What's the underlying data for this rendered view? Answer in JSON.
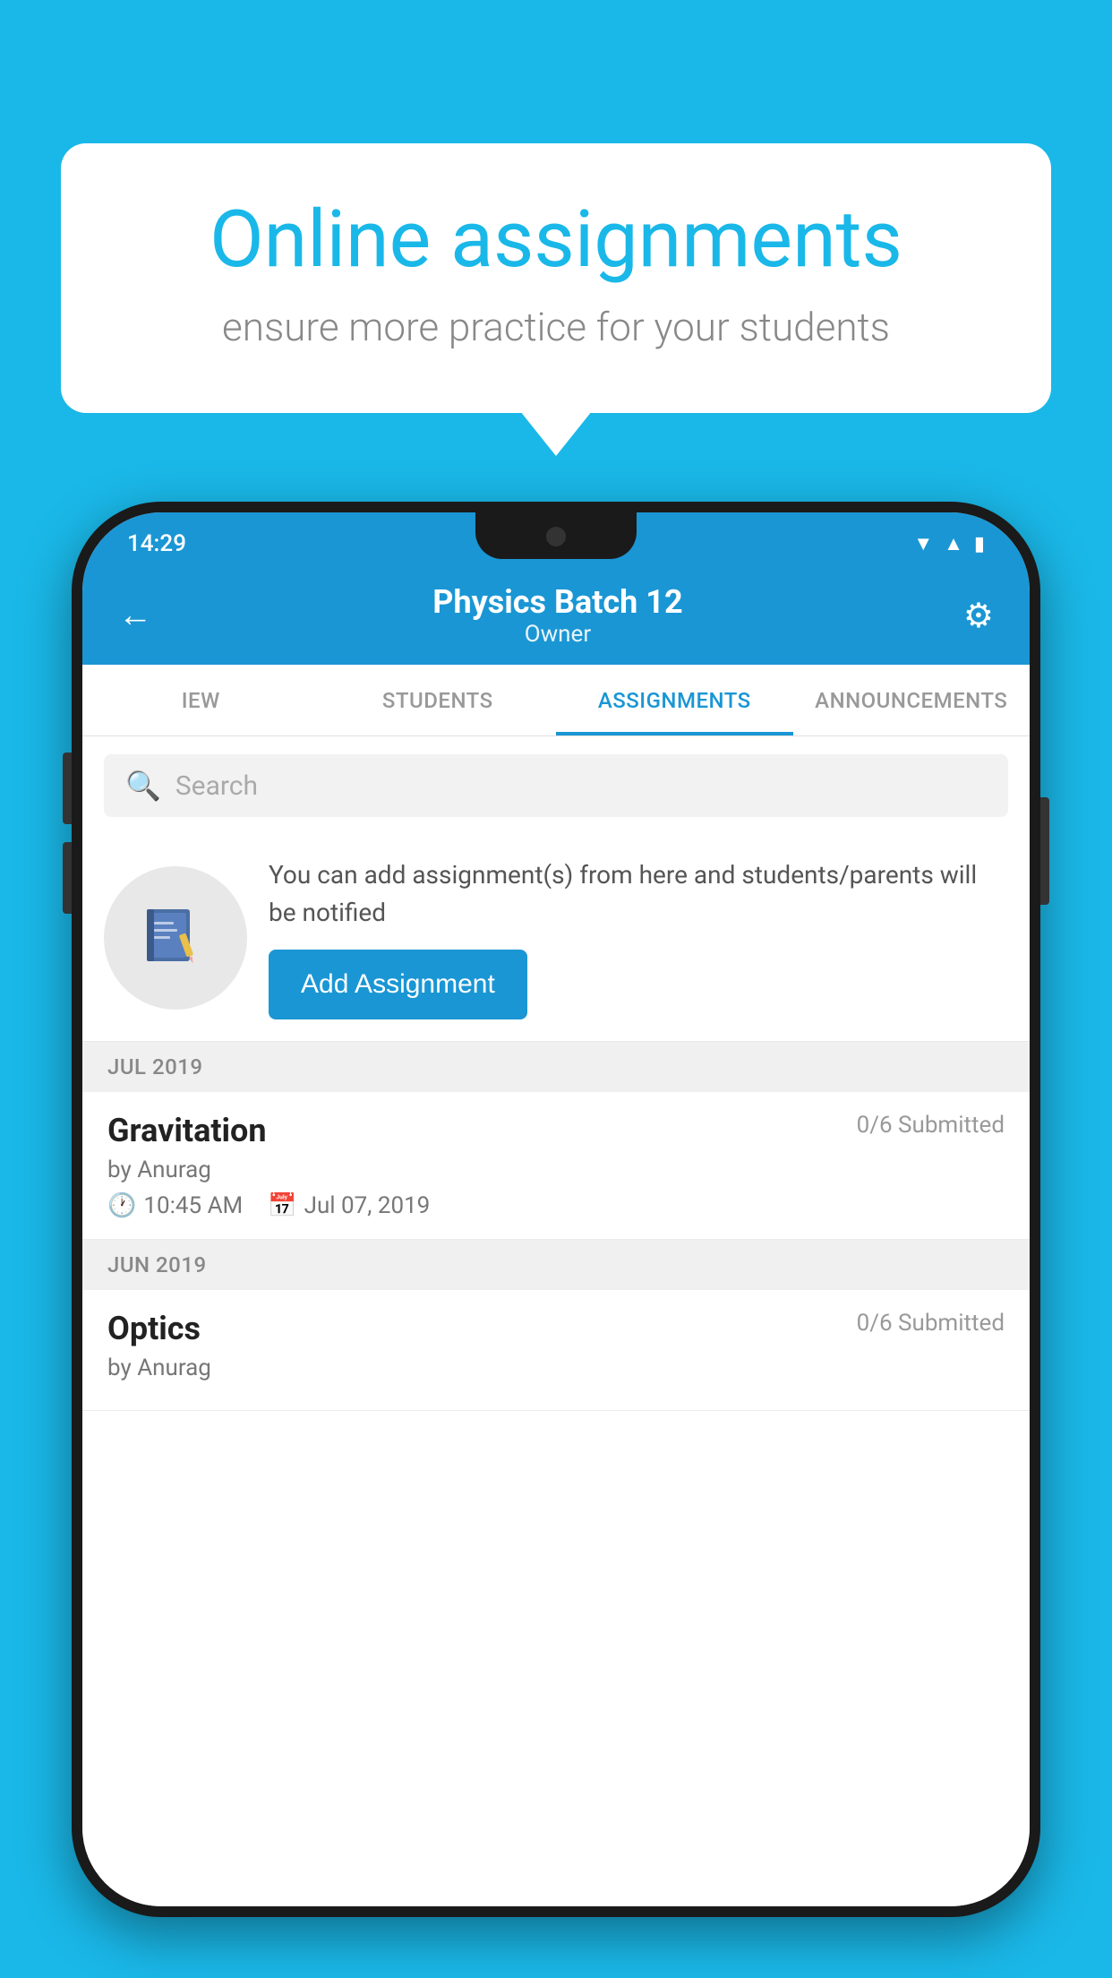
{
  "background_color": "#1ab8e8",
  "speech_bubble": {
    "title": "Online assignments",
    "subtitle": "ensure more practice for your students"
  },
  "status_bar": {
    "time": "14:29",
    "icons": [
      "wifi",
      "signal",
      "battery"
    ]
  },
  "app_bar": {
    "back_label": "←",
    "title": "Physics Batch 12",
    "subtitle": "Owner",
    "settings_label": "⚙"
  },
  "tabs": [
    {
      "label": "IEW",
      "active": false
    },
    {
      "label": "STUDENTS",
      "active": false
    },
    {
      "label": "ASSIGNMENTS",
      "active": true
    },
    {
      "label": "ANNOUNCEMENTS",
      "active": false
    }
  ],
  "search": {
    "placeholder": "Search"
  },
  "info_section": {
    "description": "You can add assignment(s) from here and students/parents will be notified",
    "add_button_label": "Add Assignment"
  },
  "months": [
    {
      "label": "JUL 2019",
      "assignments": [
        {
          "title": "Gravitation",
          "submitted": "0/6 Submitted",
          "author": "by Anurag",
          "time": "10:45 AM",
          "date": "Jul 07, 2019"
        }
      ]
    },
    {
      "label": "JUN 2019",
      "assignments": [
        {
          "title": "Optics",
          "submitted": "0/6 Submitted",
          "author": "by Anurag",
          "time": "",
          "date": ""
        }
      ]
    }
  ]
}
